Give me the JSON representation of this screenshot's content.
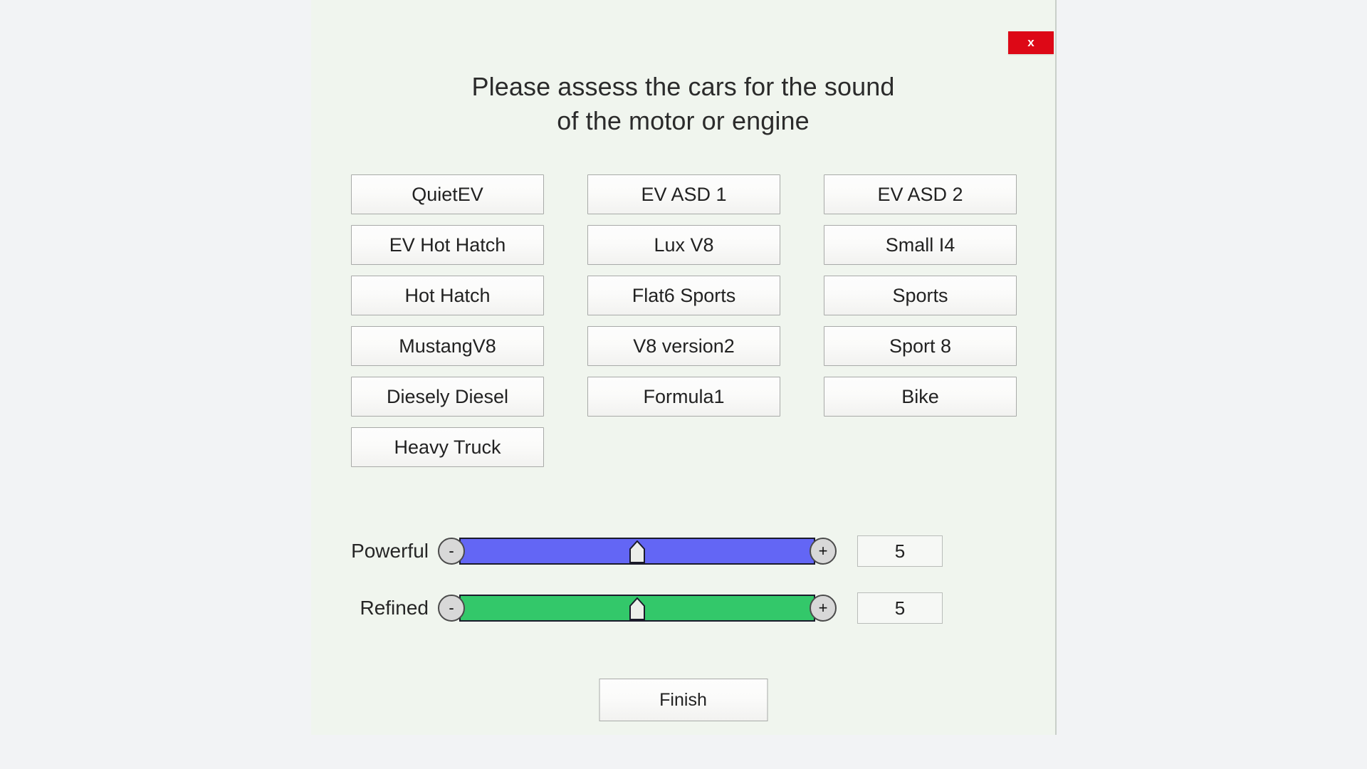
{
  "window": {
    "close_label": "x",
    "background_color": "#f0f5ee",
    "desktop_color": "#f2f3f5"
  },
  "prompt": {
    "text": "Please assess the cars for the sound\nof the motor or engine"
  },
  "sound_buttons": [
    "QuietEV",
    "EV ASD 1",
    "EV ASD 2",
    "EV Hot Hatch",
    "Lux V8",
    "Small I4",
    "Hot Hatch",
    "Flat6 Sports",
    "Sports",
    "MustangV8",
    "V8 version2",
    "Sport 8",
    "Diesely Diesel",
    "Formula1",
    "Bike",
    "Heavy Truck"
  ],
  "sliders": [
    {
      "label": "Powerful",
      "value": "5",
      "percent": 50,
      "color": "#6366f5",
      "minus_label": "-",
      "plus_label": "+"
    },
    {
      "label": "Refined",
      "value": "5",
      "percent": 50,
      "color": "#33c86a",
      "minus_label": "-",
      "plus_label": "+"
    }
  ],
  "finish": {
    "label": "Finish"
  }
}
